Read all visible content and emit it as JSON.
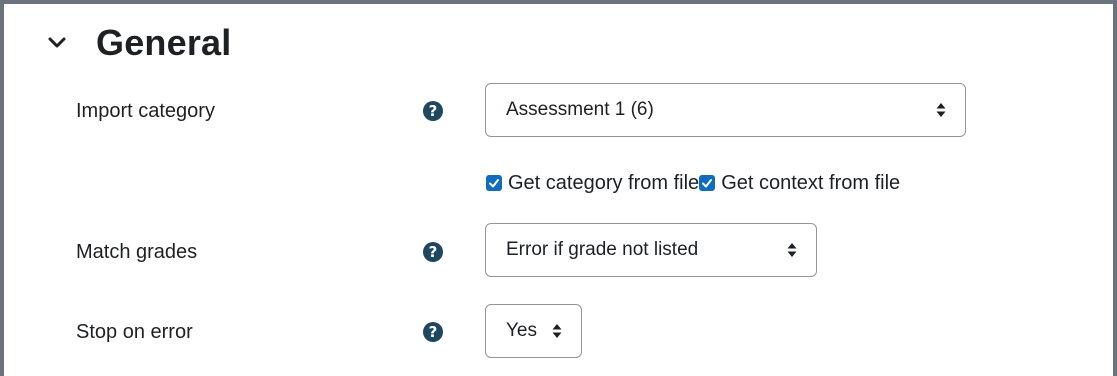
{
  "section": {
    "title": "General",
    "expanded": true,
    "icon": "chevron-down-icon"
  },
  "fields": {
    "import_category": {
      "label": "Import category",
      "help_icon": "question-circle-icon",
      "value": "Assessment 1 (6)"
    },
    "match_grades": {
      "label": "Match grades",
      "help_icon": "question-circle-icon",
      "value": "Error if grade not listed"
    },
    "stop_on_error": {
      "label": "Stop on error",
      "help_icon": "question-circle-icon",
      "value": "Yes"
    }
  },
  "checkboxes": [
    {
      "label": "Get category from file",
      "checked": true
    },
    {
      "label": "Get context from file",
      "checked": true
    }
  ],
  "colors": {
    "accent": "#0f6cbf",
    "help_icon": "#1f4860",
    "border": "#8f959e",
    "text": "#1d2125"
  }
}
